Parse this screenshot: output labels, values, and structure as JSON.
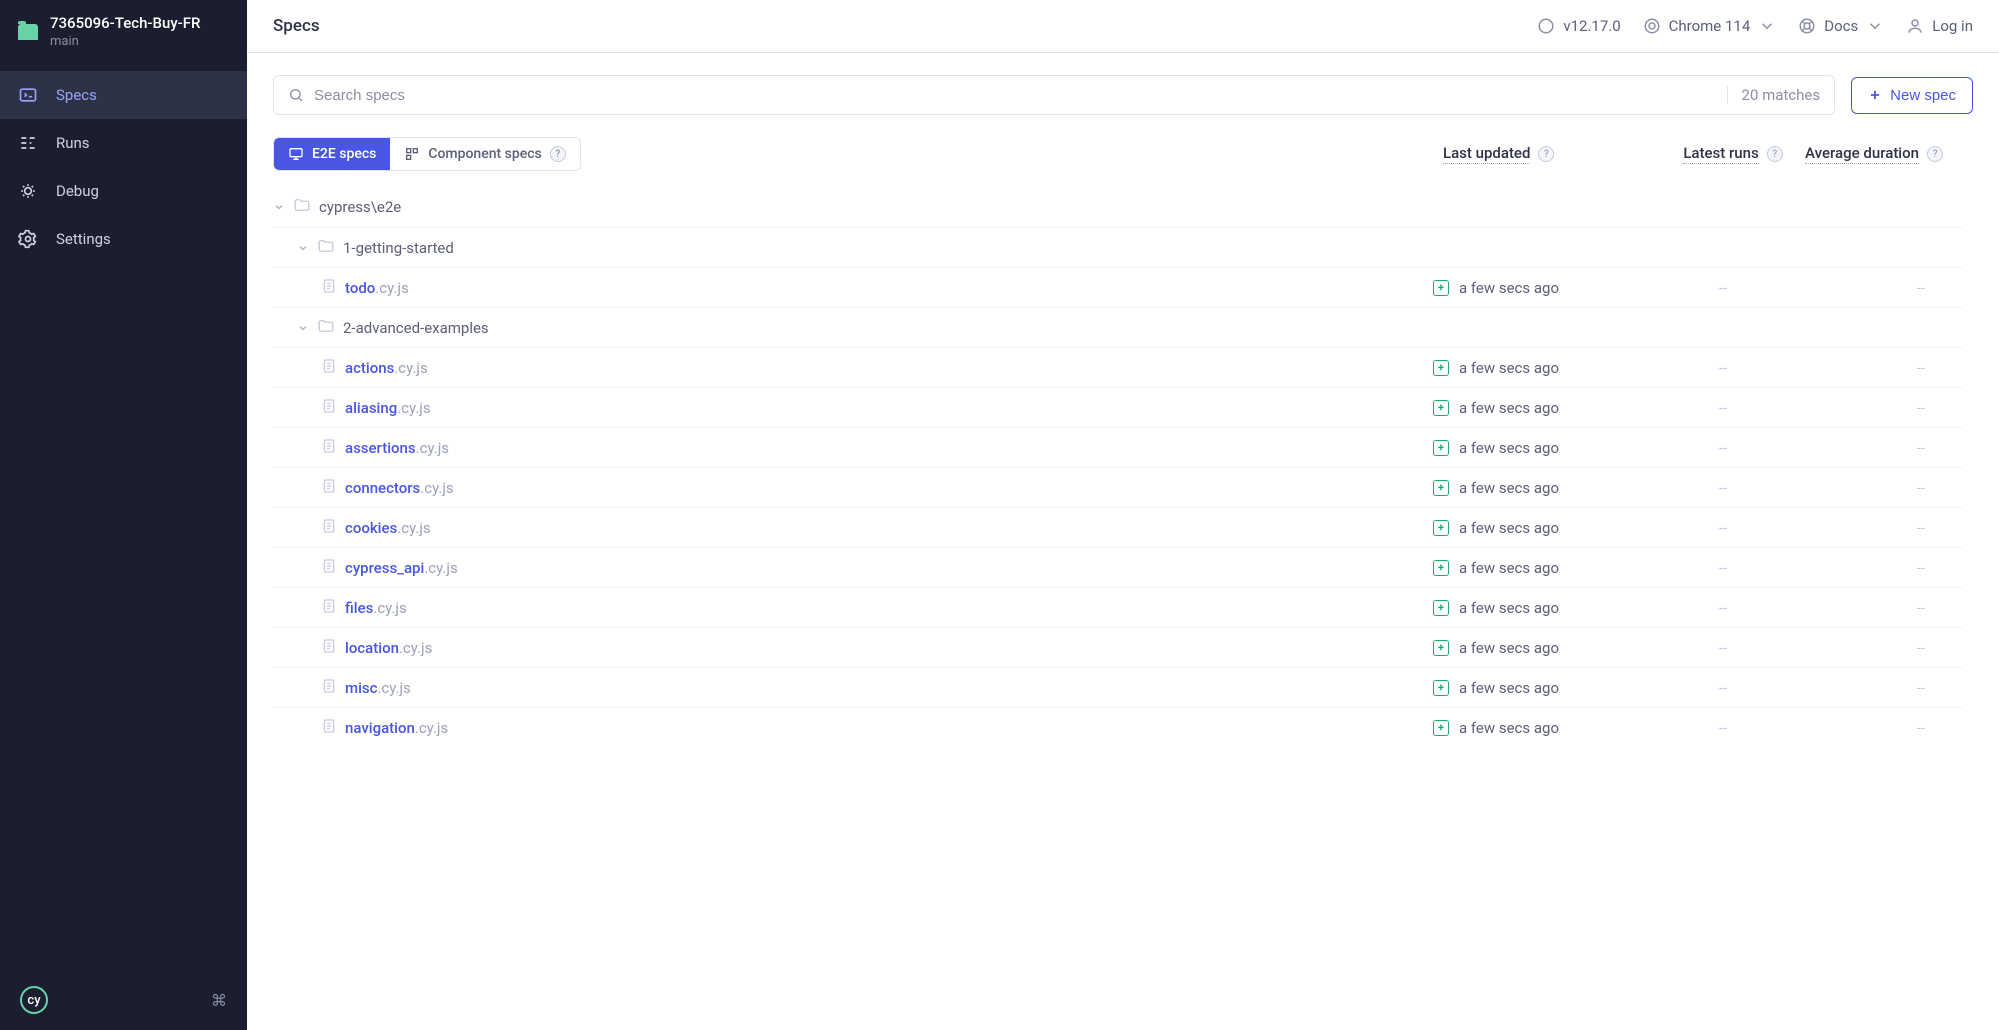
{
  "project": {
    "name": "7365096-Tech-Buy-FR",
    "branch": "main"
  },
  "nav": {
    "items": [
      {
        "label": "Specs",
        "active": true
      },
      {
        "label": "Runs",
        "active": false
      },
      {
        "label": "Debug",
        "active": false
      },
      {
        "label": "Settings",
        "active": false
      }
    ]
  },
  "page": {
    "title": "Specs"
  },
  "topbar": {
    "version": "v12.17.0",
    "browser": "Chrome 114",
    "docs": "Docs",
    "login": "Log in"
  },
  "search": {
    "placeholder": "Search specs",
    "match_text": "20 matches"
  },
  "buttons": {
    "new_spec": "New spec"
  },
  "tabs": {
    "e2e": "E2E specs",
    "component": "Component specs"
  },
  "columns": {
    "updated": "Last updated",
    "runs": "Latest runs",
    "duration": "Average duration"
  },
  "empty_dash": "--",
  "tree": [
    {
      "type": "folder",
      "indent": 0,
      "label": "cypress\\e2e"
    },
    {
      "type": "folder",
      "indent": 1,
      "label": "1-getting-started"
    },
    {
      "type": "spec",
      "indent": 2,
      "name": "todo",
      "ext": ".cy.js",
      "updated": "a few secs ago"
    },
    {
      "type": "folder",
      "indent": 1,
      "label": "2-advanced-examples"
    },
    {
      "type": "spec",
      "indent": 2,
      "name": "actions",
      "ext": ".cy.js",
      "updated": "a few secs ago"
    },
    {
      "type": "spec",
      "indent": 2,
      "name": "aliasing",
      "ext": ".cy.js",
      "updated": "a few secs ago"
    },
    {
      "type": "spec",
      "indent": 2,
      "name": "assertions",
      "ext": ".cy.js",
      "updated": "a few secs ago"
    },
    {
      "type": "spec",
      "indent": 2,
      "name": "connectors",
      "ext": ".cy.js",
      "updated": "a few secs ago"
    },
    {
      "type": "spec",
      "indent": 2,
      "name": "cookies",
      "ext": ".cy.js",
      "updated": "a few secs ago"
    },
    {
      "type": "spec",
      "indent": 2,
      "name": "cypress_api",
      "ext": ".cy.js",
      "updated": "a few secs ago"
    },
    {
      "type": "spec",
      "indent": 2,
      "name": "files",
      "ext": ".cy.js",
      "updated": "a few secs ago"
    },
    {
      "type": "spec",
      "indent": 2,
      "name": "location",
      "ext": ".cy.js",
      "updated": "a few secs ago"
    },
    {
      "type": "spec",
      "indent": 2,
      "name": "misc",
      "ext": ".cy.js",
      "updated": "a few secs ago"
    },
    {
      "type": "spec",
      "indent": 2,
      "name": "navigation",
      "ext": ".cy.js",
      "updated": "a few secs ago"
    }
  ]
}
